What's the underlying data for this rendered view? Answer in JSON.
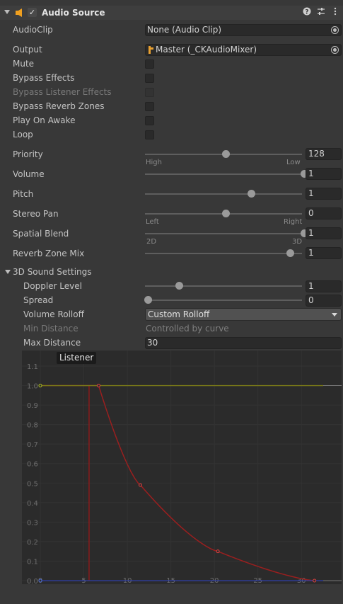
{
  "header": {
    "title": "Audio Source",
    "enabled": true,
    "icons": [
      "audio-source-icon",
      "help-icon",
      "presets-icon",
      "more-icon"
    ]
  },
  "fields": {
    "audio_clip": {
      "label": "AudioClip",
      "value": "None (Audio Clip)"
    },
    "output": {
      "label": "Output",
      "value": "Master (_CKAudioMixer)"
    },
    "mute": {
      "label": "Mute",
      "checked": false
    },
    "bypass_effects": {
      "label": "Bypass Effects",
      "checked": false
    },
    "bypass_listener_effects": {
      "label": "Bypass Listener Effects",
      "checked": false,
      "disabled": true
    },
    "bypass_reverb_zones": {
      "label": "Bypass Reverb Zones",
      "checked": false
    },
    "play_on_awake": {
      "label": "Play On Awake",
      "checked": false
    },
    "loop": {
      "label": "Loop",
      "checked": false
    }
  },
  "sliders": {
    "priority": {
      "label": "Priority",
      "value": "128",
      "fraction": 0.502,
      "min_label": "High",
      "max_label": "Low"
    },
    "volume": {
      "label": "Volume",
      "value": "1",
      "fraction": 1.0
    },
    "pitch": {
      "label": "Pitch",
      "value": "1",
      "fraction": 0.665
    },
    "stereo_pan": {
      "label": "Stereo Pan",
      "value": "0",
      "fraction": 0.5,
      "min_label": "Left",
      "max_label": "Right"
    },
    "spatial_blend": {
      "label": "Spatial Blend",
      "value": "1",
      "fraction": 1.0,
      "min_label": "2D",
      "max_label": "3D"
    },
    "reverb_zone_mix": {
      "label": "Reverb Zone Mix",
      "value": "1",
      "fraction": 0.91
    }
  },
  "sound3d": {
    "section_label": "3D Sound Settings",
    "doppler_level": {
      "label": "Doppler Level",
      "value": "1",
      "fraction": 0.2
    },
    "spread": {
      "label": "Spread",
      "value": "0",
      "fraction": 0.0
    },
    "volume_rolloff": {
      "label": "Volume Rolloff",
      "value": "Custom Rolloff"
    },
    "min_distance": {
      "label": "Min Distance",
      "value": "Controlled by curve"
    },
    "max_distance": {
      "label": "Max Distance",
      "value": "30"
    }
  },
  "chart_data": {
    "type": "line",
    "title": "",
    "annotation": "Listener",
    "xlim": [
      0,
      32.5
    ],
    "ylim": [
      0,
      1.1
    ],
    "x_ticks": [
      "0",
      "5",
      "10",
      "15",
      "20",
      "25",
      "30"
    ],
    "y_ticks": [
      "0.0",
      "0.1",
      "0.2",
      "0.3",
      "0.4",
      "0.5",
      "0.6",
      "0.7",
      "0.8",
      "0.9",
      "1.0",
      "1.1"
    ],
    "listener_x": 5.6,
    "series": [
      {
        "color": "#9a1f1f",
        "points": [
          [
            0,
            1
          ],
          [
            6.7,
            1
          ],
          [
            11.5,
            0.49
          ],
          [
            20.4,
            0.15
          ],
          [
            31.5,
            0
          ]
        ]
      },
      {
        "color": "#7a7a18",
        "points": [
          [
            0,
            1
          ],
          [
            32.5,
            1
          ]
        ]
      },
      {
        "color": "#2f3fa8",
        "points": [
          [
            0,
            0
          ],
          [
            32.5,
            0
          ]
        ]
      }
    ]
  }
}
